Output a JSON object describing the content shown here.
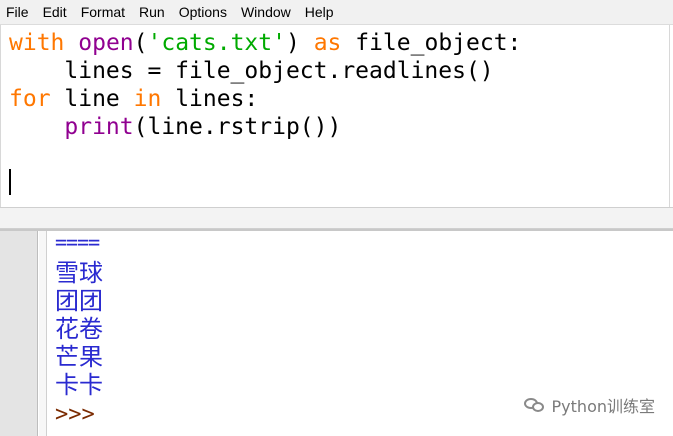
{
  "menu": {
    "items": [
      {
        "label": "File"
      },
      {
        "label": "Edit"
      },
      {
        "label": "Format"
      },
      {
        "label": "Run"
      },
      {
        "label": "Options"
      },
      {
        "label": "Window"
      },
      {
        "label": "Help"
      }
    ]
  },
  "editor": {
    "lines": [
      {
        "tokens": [
          {
            "text": "with",
            "cls": "kw"
          },
          {
            "text": " "
          },
          {
            "text": "open",
            "cls": "bi"
          },
          {
            "text": "("
          },
          {
            "text": "'cats.txt'",
            "cls": "str"
          },
          {
            "text": ") "
          },
          {
            "text": "as",
            "cls": "kw"
          },
          {
            "text": " file_object:"
          }
        ]
      },
      {
        "tokens": [
          {
            "text": "    lines = file_object.readlines()"
          }
        ]
      },
      {
        "tokens": [
          {
            "text": "for",
            "cls": "kw"
          },
          {
            "text": " line "
          },
          {
            "text": "in",
            "cls": "kw"
          },
          {
            "text": " lines:"
          }
        ]
      },
      {
        "tokens": [
          {
            "text": "    "
          },
          {
            "text": "print",
            "cls": "bi"
          },
          {
            "text": "(line.rstrip())"
          }
        ]
      }
    ]
  },
  "shell": {
    "separator": "====",
    "output": [
      "雪球",
      "团团",
      "花卷",
      "芒果",
      "卡卡"
    ],
    "prompt": ">>>"
  },
  "watermark": {
    "text": "Python训练室"
  }
}
